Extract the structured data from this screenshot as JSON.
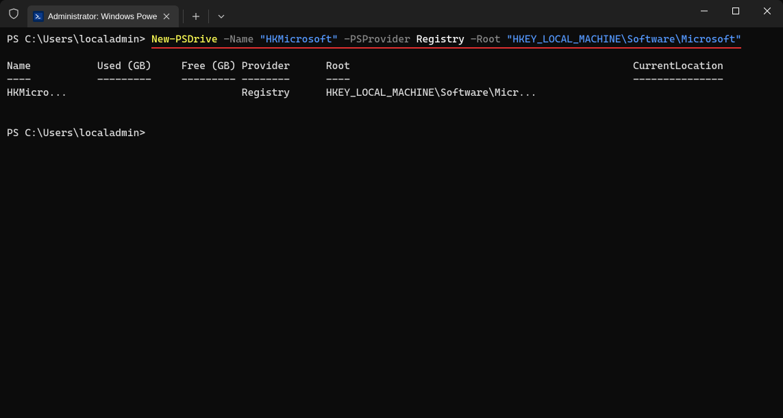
{
  "titlebar": {
    "tab_title": "Administrator: Windows Powe"
  },
  "terminal": {
    "prompt1": "PS C:\\Users\\localadmin> ",
    "cmd": "New-PSDrive",
    "p_name": " -Name ",
    "v_name": "\"HKMicrosoft\"",
    "p_psprovider": " -PSProvider ",
    "v_psprovider": "Registry",
    "p_root": " -Root ",
    "v_root": "\"HKEY_LOCAL_MACHINE\\Software\\Microsoft\"",
    "blank": "",
    "header": "Name           Used (GB)     Free (GB) Provider      Root                                               CurrentLocation",
    "divider": "----           ---------     --------- --------      ----                                               ---------------",
    "row1": "HKMicro...                             Registry      HKEY_LOCAL_MACHINE\\Software\\Micr...",
    "prompt2": "PS C:\\Users\\localadmin>"
  }
}
